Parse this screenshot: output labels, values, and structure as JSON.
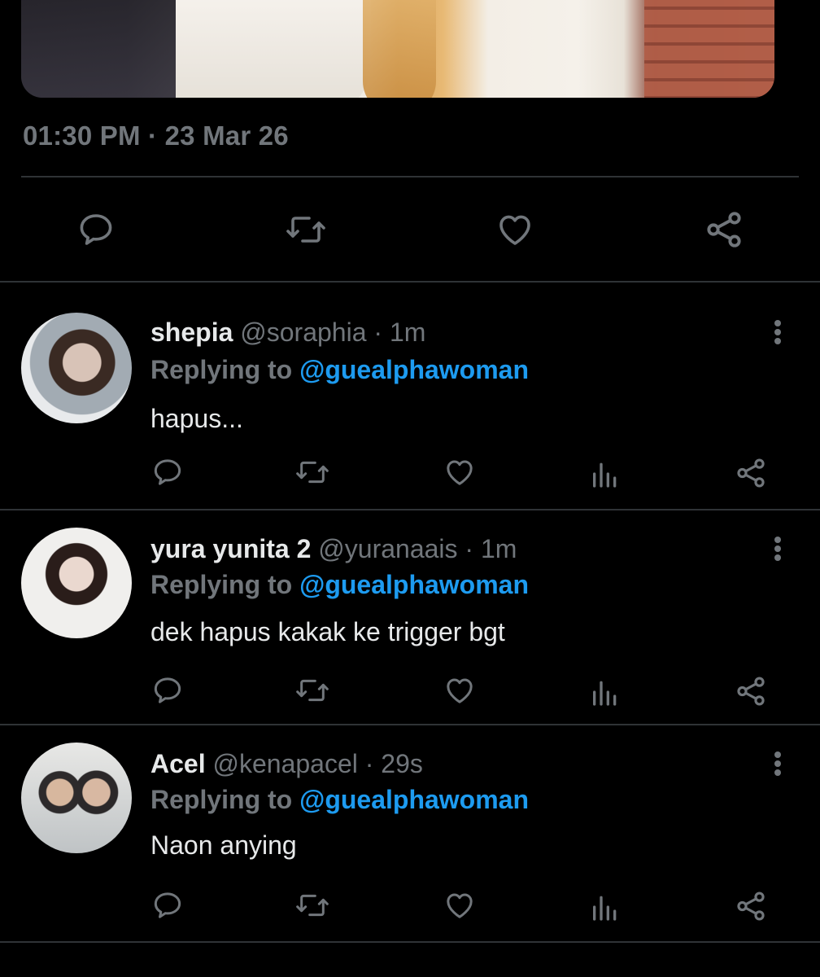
{
  "tweet": {
    "timestamp": "01:30 PM · 23 Mar 26"
  },
  "replies": [
    {
      "display_name": "shepia",
      "handle": "@soraphia",
      "separator": "·",
      "time": "1m",
      "replying_prefix": "Replying to",
      "replying_handle": "@guealphawoman",
      "text": "hapus..."
    },
    {
      "display_name": "yura yunita 2",
      "handle": "@yuranaais",
      "separator": "·",
      "time": "1m",
      "replying_prefix": "Replying to",
      "replying_handle": "@guealphawoman",
      "text": "dek hapus kakak ke trigger bgt"
    },
    {
      "display_name": "Acel",
      "handle": "@kenapacel",
      "separator": "·",
      "time": "29s",
      "replying_prefix": "Replying to",
      "replying_handle": "@guealphawoman",
      "text": "Naon anying"
    }
  ],
  "icons": {
    "reply": "reply-icon",
    "retweet": "retweet-icon",
    "like": "heart-icon",
    "views": "views-icon",
    "share": "share-icon",
    "more": "more-options-icon"
  },
  "colors": {
    "background": "#000000",
    "text_primary": "#e7e9ea",
    "text_secondary": "#71767b",
    "link": "#1d9bf0",
    "divider": "#2f3336"
  }
}
